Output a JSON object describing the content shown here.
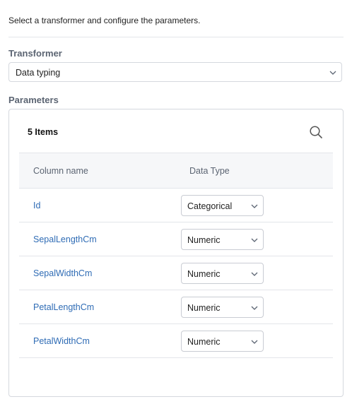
{
  "instruction": "Select a transformer and configure the parameters.",
  "transformer": {
    "label": "Transformer",
    "selected": "Data typing"
  },
  "parameters": {
    "label": "Parameters",
    "items_count": "5 Items",
    "columns": [
      "Column name",
      "Data Type"
    ],
    "rows": [
      {
        "name": "Id",
        "type": "Categorical"
      },
      {
        "name": "SepalLengthCm",
        "type": "Numeric"
      },
      {
        "name": "SepalWidthCm",
        "type": "Numeric"
      },
      {
        "name": "PetalLengthCm",
        "type": "Numeric"
      },
      {
        "name": "PetalWidthCm",
        "type": "Numeric"
      }
    ]
  },
  "icons": {
    "search": "search-icon",
    "dropdown": "chevron-down-icon"
  },
  "colors": {
    "link": "#2f6cb5",
    "label": "#5b6472",
    "border": "#d5d8de"
  }
}
